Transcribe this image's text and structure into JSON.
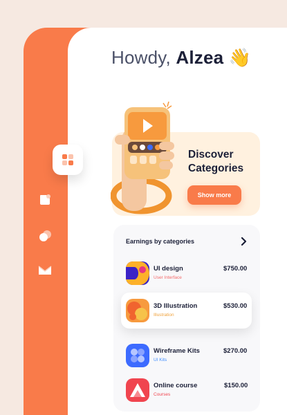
{
  "greeting": {
    "prefix": "Howdy,",
    "name": "Alzea",
    "emoji": "👋"
  },
  "discover": {
    "title": "Discover Categories",
    "button": "Show more"
  },
  "earnings": {
    "header": "Earnings by categories",
    "items": [
      {
        "name": "UI design",
        "sub": "User Interface",
        "amount": "$750.00",
        "sub_color": "#f46a6a"
      },
      {
        "name": "3D Illustration",
        "sub": "Illustration",
        "amount": "$530.00",
        "sub_color": "#f0a23c"
      },
      {
        "name": "Wireframe Kits",
        "sub": "UI Kits",
        "amount": "$270.00",
        "sub_color": "#3d8bff"
      },
      {
        "name": "Online course",
        "sub": "Courses",
        "amount": "$150.00",
        "sub_color": "#f0454f"
      }
    ]
  },
  "sidebar": {
    "icons": [
      "grid-icon",
      "document-icon",
      "circles-icon",
      "mail-icon"
    ]
  },
  "colors": {
    "accent": "#f97b4a",
    "background": "#f6e9e1",
    "card": "#fff1df"
  }
}
